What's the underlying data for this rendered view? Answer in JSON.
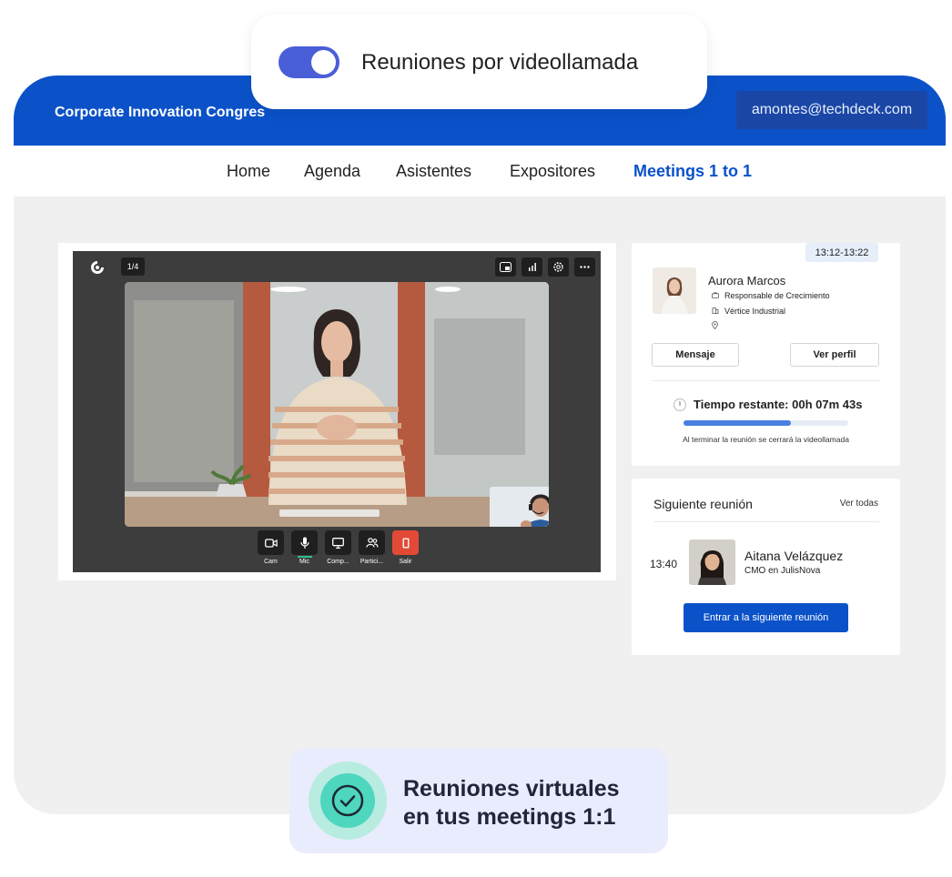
{
  "toggle": {
    "label": "Reuniones por videollamada",
    "on": true
  },
  "header": {
    "title": "Corporate Innovation Congres",
    "user_email": "amontes@techdeck.com"
  },
  "nav": {
    "items": [
      "Home",
      "Agenda",
      "Asistentes",
      "Expositores",
      "Meetings 1 to 1"
    ],
    "active": "Meetings 1 to 1"
  },
  "video": {
    "page_indicator": "1/4",
    "controls": [
      "Cam",
      "Mic",
      "Comp...",
      "Partici...",
      "Salir"
    ]
  },
  "profile": {
    "time_slot": "13:12-13:22",
    "name": "Aurora Marcos",
    "role": "Responsable de Crecimiento",
    "company": "Vértice Industrial",
    "message_button": "Mensaje",
    "profile_button": "Ver perfil",
    "timer_text": "Tiempo restante: 00h 07m 43s",
    "progress_fraction": 0.65,
    "note": "Al terminar la reunión se cerrará la videollamada"
  },
  "next_meeting": {
    "title": "Siguiente reunión",
    "see_all": "Ver todas",
    "time": "13:40",
    "name": "Aitana Velázquez",
    "role": "CMO en JulisNova",
    "join_button": "Entrar a la siguiente reunión"
  },
  "badge": {
    "line1": "Reuniones virtuales",
    "line2": "en tus meetings 1:1"
  },
  "colors": {
    "brand": "#0b52c9",
    "toggle": "#4a5ed8",
    "accent_green": "#4fd6be",
    "end_call": "#e34a35"
  }
}
